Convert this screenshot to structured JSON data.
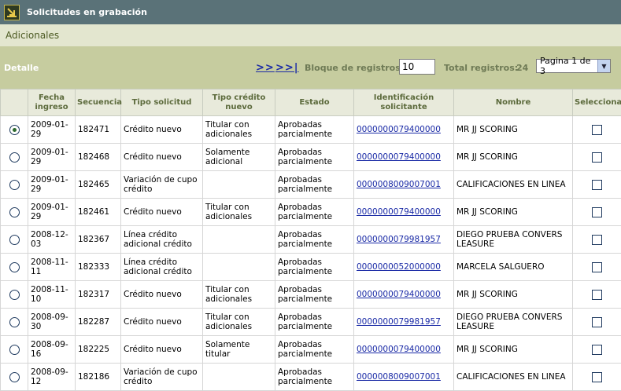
{
  "title": "Solicitudes en grabación",
  "subtitle": "Adicionales",
  "toolbar": {
    "detalle": "Detalle",
    "next": ">>",
    "last": ">>|",
    "bloque_label": "Bloque de registros:",
    "bloque_value": "10",
    "total_label": "Total registros:",
    "total_value": "24",
    "page_selected": "Pagina 1 de 3"
  },
  "columns": [
    "",
    "Fecha ingreso",
    "Secuencia",
    "Tipo solicitud",
    "Tipo crédito nuevo",
    "Estado",
    "Identificación solicitante",
    "Nombre",
    "Seleccionar"
  ],
  "rows": [
    {
      "selected": true,
      "fecha": "2009-01-29",
      "secuencia": "182471",
      "tipo": "Crédito nuevo",
      "tipo_credito": "Titular con adicionales",
      "estado": "Aprobadas parcialmente",
      "id": "0000000079400000",
      "nombre": "MR JJ SCORING"
    },
    {
      "selected": false,
      "fecha": "2009-01-29",
      "secuencia": "182468",
      "tipo": "Crédito nuevo",
      "tipo_credito": "Solamente adicional",
      "estado": "Aprobadas parcialmente",
      "id": "0000000079400000",
      "nombre": "MR JJ SCORING"
    },
    {
      "selected": false,
      "fecha": "2009-01-29",
      "secuencia": "182465",
      "tipo": "Variación de cupo crédito",
      "tipo_credito": "",
      "estado": "Aprobadas parcialmente",
      "id": "0000008009007001",
      "nombre": "CALIFICACIONES EN LINEA"
    },
    {
      "selected": false,
      "fecha": "2009-01-29",
      "secuencia": "182461",
      "tipo": "Crédito nuevo",
      "tipo_credito": "Titular con adicionales",
      "estado": "Aprobadas parcialmente",
      "id": "0000000079400000",
      "nombre": "MR JJ SCORING"
    },
    {
      "selected": false,
      "fecha": "2008-12-03",
      "secuencia": "182367",
      "tipo": "Línea crédito adicional crédito",
      "tipo_credito": "",
      "estado": "Aprobadas parcialmente",
      "id": "0000000079981957",
      "nombre": "DIEGO PRUEBA CONVERS LEASURE"
    },
    {
      "selected": false,
      "fecha": "2008-11-11",
      "secuencia": "182333",
      "tipo": "Línea crédito adicional crédito",
      "tipo_credito": "",
      "estado": "Aprobadas parcialmente",
      "id": "0000000052000000",
      "nombre": "MARCELA SALGUERO"
    },
    {
      "selected": false,
      "fecha": "2008-11-10",
      "secuencia": "182317",
      "tipo": "Crédito nuevo",
      "tipo_credito": "Titular con adicionales",
      "estado": "Aprobadas parcialmente",
      "id": "0000000079400000",
      "nombre": "MR JJ SCORING"
    },
    {
      "selected": false,
      "fecha": "2008-09-30",
      "secuencia": "182287",
      "tipo": "Crédito nuevo",
      "tipo_credito": "Titular con adicionales",
      "estado": "Aprobadas parcialmente",
      "id": "0000000079981957",
      "nombre": "DIEGO PRUEBA CONVERS LEASURE"
    },
    {
      "selected": false,
      "fecha": "2008-09-16",
      "secuencia": "182225",
      "tipo": "Crédito nuevo",
      "tipo_credito": "Solamente titular",
      "estado": "Aprobadas parcialmente",
      "id": "0000000079400000",
      "nombre": "MR JJ SCORING"
    },
    {
      "selected": false,
      "fecha": "2008-09-12",
      "secuencia": "182186",
      "tipo": "Variación de cupo crédito",
      "tipo_credito": "",
      "estado": "Aprobadas parcialmente",
      "id": "0000008009007001",
      "nombre": "CALIFICACIONES EN LINEA"
    }
  ]
}
